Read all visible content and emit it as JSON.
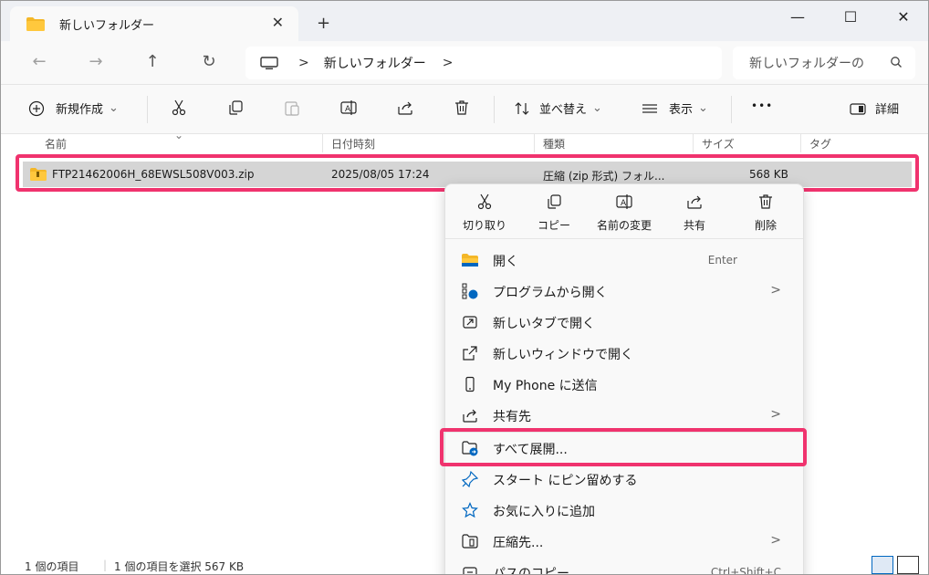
{
  "tab": {
    "title": "新しいフォルダー",
    "close": "✕",
    "new": "+"
  },
  "window_controls": {
    "minimize": "—",
    "maximize": "☐",
    "close": "✕"
  },
  "nav": {
    "back": "←",
    "forward": "→",
    "up": "↑",
    "refresh": "↻"
  },
  "address": {
    "separator": ">",
    "crumb": "新しいフォルダー",
    "chevron": ">"
  },
  "search": {
    "placeholder": "新しいフォルダーの"
  },
  "toolbar": {
    "new_label": "新規作成",
    "new_chevron": "⌄",
    "sort_label": "並べ替え",
    "sort_chevron": "⌄",
    "view_label": "表示",
    "view_chevron": "⌄",
    "more": "•••",
    "details_label": "詳細"
  },
  "columns": {
    "name": "名前",
    "date": "日付時刻",
    "type": "種類",
    "size": "サイズ",
    "tag": "タグ",
    "sort_indicator": "⌄"
  },
  "files": [
    {
      "name": "FTP21462006H_68EWSL508V003.zip",
      "date": "2025/08/05 17:24",
      "type": "圧縮 (zip 形式) フォル...",
      "size": "568 KB"
    }
  ],
  "context_menu": {
    "quick_actions": [
      {
        "label": "切り取り",
        "icon": "cut-icon"
      },
      {
        "label": "コピー",
        "icon": "copy-icon"
      },
      {
        "label": "名前の変更",
        "icon": "rename-icon"
      },
      {
        "label": "共有",
        "icon": "share-icon"
      },
      {
        "label": "削除",
        "icon": "delete-icon"
      }
    ],
    "items": [
      {
        "label": "開く",
        "shortcut": "Enter",
        "icon": "folder-icon"
      },
      {
        "label": "プログラムから開く",
        "arrow": ">",
        "icon": "open-with-icon"
      },
      {
        "label": "新しいタブで開く",
        "icon": "new-tab-icon"
      },
      {
        "label": "新しいウィンドウで開く",
        "icon": "new-window-icon"
      },
      {
        "label": "My Phone に送信",
        "icon": "phone-icon"
      },
      {
        "label": "共有先",
        "arrow": ">",
        "icon": "share-icon"
      },
      {
        "label": "すべて展開...",
        "icon": "extract-icon"
      },
      {
        "label": "スタート にピン留めする",
        "icon": "pin-icon"
      },
      {
        "label": "お気に入りに追加",
        "icon": "star-icon"
      },
      {
        "label": "圧縮先...",
        "arrow": ">",
        "icon": "compress-icon"
      },
      {
        "label": "パスのコピー",
        "shortcut": "Ctrl+Shift+C",
        "icon": "path-copy-icon"
      }
    ]
  },
  "status": {
    "item_count": "1 個の項目",
    "selected": "1 個の項目を選択  567 KB"
  },
  "colors": {
    "highlight": "#f0336e",
    "selection": "#d5d5d5",
    "accent": "#0067c0"
  }
}
